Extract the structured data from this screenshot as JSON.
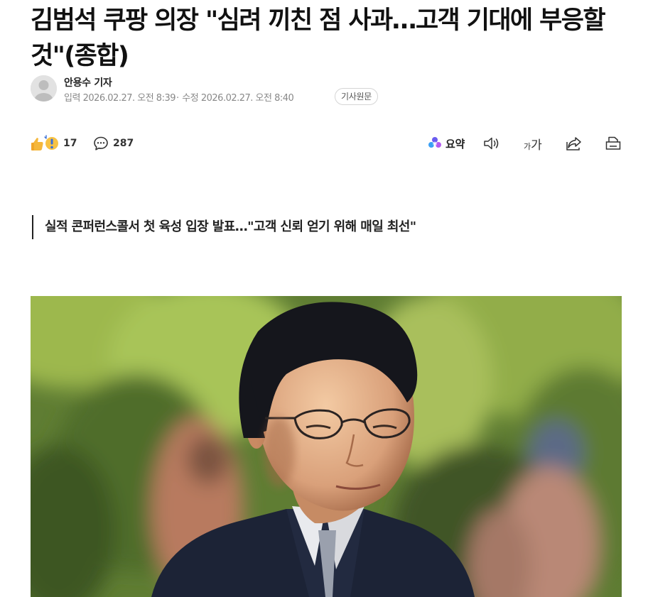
{
  "article": {
    "headline": "김범석 쿠팡 의장 \"심려 끼친 점 사과…고객 기대에 부응할 것\"(종합)",
    "subtitle": "실적 콘퍼런스콜서 첫 육성 입장 발표…\"고객 신뢰 얻기 위해 매일 최선\""
  },
  "byline": {
    "reporter": "안용수 기자",
    "published_label": "입력",
    "published": "2026.02.27. 오전 8:39",
    "modified_label": "수정",
    "modified": "2026.02.27. 오전 8:40",
    "original_button": "기사원문"
  },
  "toolbar": {
    "reaction_count": "17",
    "comment_count": "287",
    "summary_label": "요약",
    "font_small": "가",
    "font_large": "가",
    "icons": [
      "reaction-icon",
      "comment-icon",
      "ai-summary-icon",
      "speaker-icon",
      "font-size-icon",
      "share-icon",
      "print-icon"
    ]
  },
  "photo": {
    "description_icon": "article-photo"
  },
  "colors": {
    "text": "#111111",
    "meta": "#888888",
    "accent_reaction": "#f5b73b"
  }
}
